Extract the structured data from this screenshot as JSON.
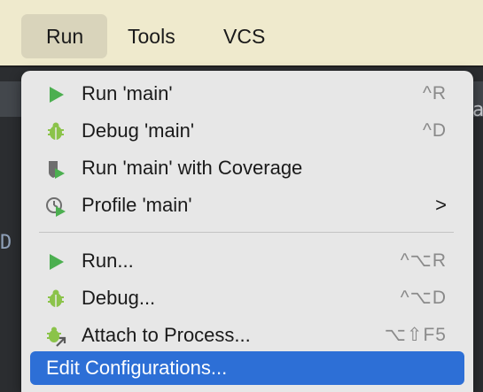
{
  "menubar": {
    "items": [
      {
        "label": "Run",
        "active": true
      },
      {
        "label": "Tools"
      },
      {
        "label": "VCS"
      }
    ]
  },
  "run_menu": {
    "items": [
      {
        "label": "Run 'main'",
        "shortcut": "^R",
        "icon": "run-icon"
      },
      {
        "label": "Debug 'main'",
        "shortcut": "^D",
        "icon": "debug-icon"
      },
      {
        "label": "Run 'main' with Coverage",
        "shortcut": "",
        "icon": "coverage-icon"
      },
      {
        "label": "Profile 'main'",
        "submenu_arrow": ">",
        "icon": "profile-icon"
      },
      {
        "label": "Run...",
        "shortcut": "^⌥R",
        "icon": "run-icon"
      },
      {
        "label": "Debug...",
        "shortcut": "^⌥D",
        "icon": "debug-icon"
      },
      {
        "label": "Attach to Process...",
        "shortcut": "⌥⇧F5",
        "icon": "attach-icon"
      },
      {
        "label": "Edit Configurations...",
        "highlighted": true
      }
    ]
  },
  "colors": {
    "menubar_bg": "#efeacd",
    "menu_bg": "#e7e7e7",
    "highlight": "#2d6fd6",
    "run_green": "#4caf50",
    "debug_green": "#7cb342"
  }
}
